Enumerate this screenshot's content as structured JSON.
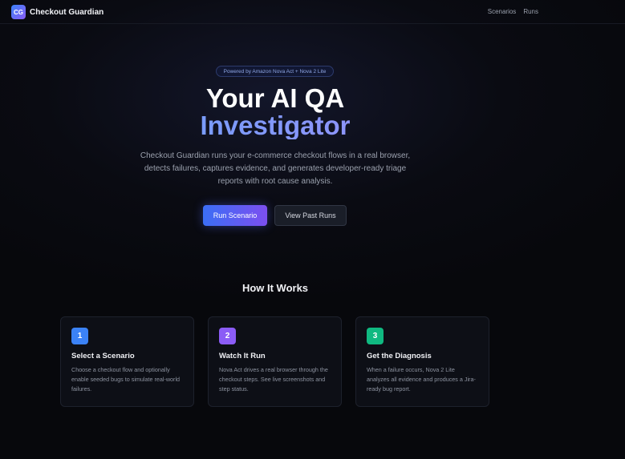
{
  "header": {
    "logo_text": "CG",
    "brand": "Checkout Guardian",
    "nav": [
      {
        "label": "Scenarios"
      },
      {
        "label": "Runs"
      }
    ]
  },
  "hero": {
    "badge": "Powered by Amazon Nova Act + Nova 2 Lite",
    "title_line1": "Your AI QA",
    "title_line2": "Investigator",
    "description": "Checkout Guardian runs your e-commerce checkout flows in a real browser, detects failures, captures evidence, and generates developer-ready triage reports with root cause analysis.",
    "primary_button": "Run Scenario",
    "secondary_button": "View Past Runs"
  },
  "how_it_works": {
    "title": "How It Works",
    "steps": [
      {
        "number": "1",
        "title": "Select a Scenario",
        "description": "Choose a checkout flow and optionally enable seeded bugs to simulate real-world failures.",
        "color": "#3b82f6"
      },
      {
        "number": "2",
        "title": "Watch It Run",
        "description": "Nova Act drives a real browser through the checkout steps. See live screenshots and step status.",
        "color": "#8b5cf6"
      },
      {
        "number": "3",
        "title": "Get the Diagnosis",
        "description": "When a failure occurs, Nova 2 Lite analyzes all evidence and produces a Jira-ready bug report.",
        "color": "#10b981"
      }
    ]
  }
}
